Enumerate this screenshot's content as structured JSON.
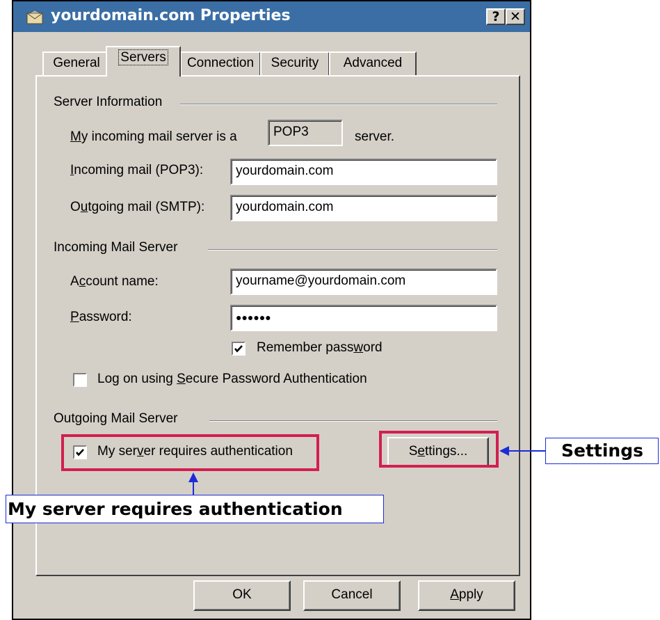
{
  "window": {
    "title": "yourdomain.com Properties",
    "help_btn": "?",
    "close_btn": "✕",
    "icon": "mail-envelope-icon"
  },
  "tabs": [
    {
      "label": "General"
    },
    {
      "label": "Servers",
      "active": true
    },
    {
      "label": "Connection"
    },
    {
      "label": "Security"
    },
    {
      "label": "Advanced"
    }
  ],
  "server_info": {
    "heading": "Server Information",
    "incoming_type_pre_u": "M",
    "incoming_type_pre_rest": "y incoming mail server is a",
    "incoming_type_value": "POP3",
    "incoming_type_post": "server.",
    "incoming_label_u": "I",
    "incoming_label_rest": "ncoming mail (POP3):",
    "incoming_value": "yourdomain.com",
    "outgoing_label_a": "O",
    "outgoing_label_u": "u",
    "outgoing_label_rest": "tgoing mail (SMTP):",
    "outgoing_value": "yourdomain.com"
  },
  "incoming_server": {
    "heading": "Incoming Mail Server",
    "account_a": "A",
    "account_u": "c",
    "account_rest": "count name:",
    "account_value": "yourname@yourdomain.com",
    "password_u": "P",
    "password_rest": "assword:",
    "password_value": "●●●●●●",
    "remember_a": "Remember pass",
    "remember_u": "w",
    "remember_rest": "ord",
    "remember_checked": true,
    "spa_a": "Log on using ",
    "spa_u": "S",
    "spa_rest": "ecure Password Authentication",
    "spa_checked": false
  },
  "outgoing_server": {
    "heading": "Outgoing Mail Server",
    "auth_a": "My ser",
    "auth_u": "v",
    "auth_rest": "er requires authentication",
    "auth_checked": true,
    "settings_a": "S",
    "settings_u": "e",
    "settings_rest": "ttings..."
  },
  "buttons": {
    "ok": "OK",
    "cancel": "Cancel",
    "apply_u": "A",
    "apply_rest": "pply"
  },
  "annotations": {
    "settings_callout": "Settings",
    "auth_callout": "My server requires authentication",
    "highlight_color": "#d21f4f",
    "callout_color": "#1c2bd8"
  }
}
